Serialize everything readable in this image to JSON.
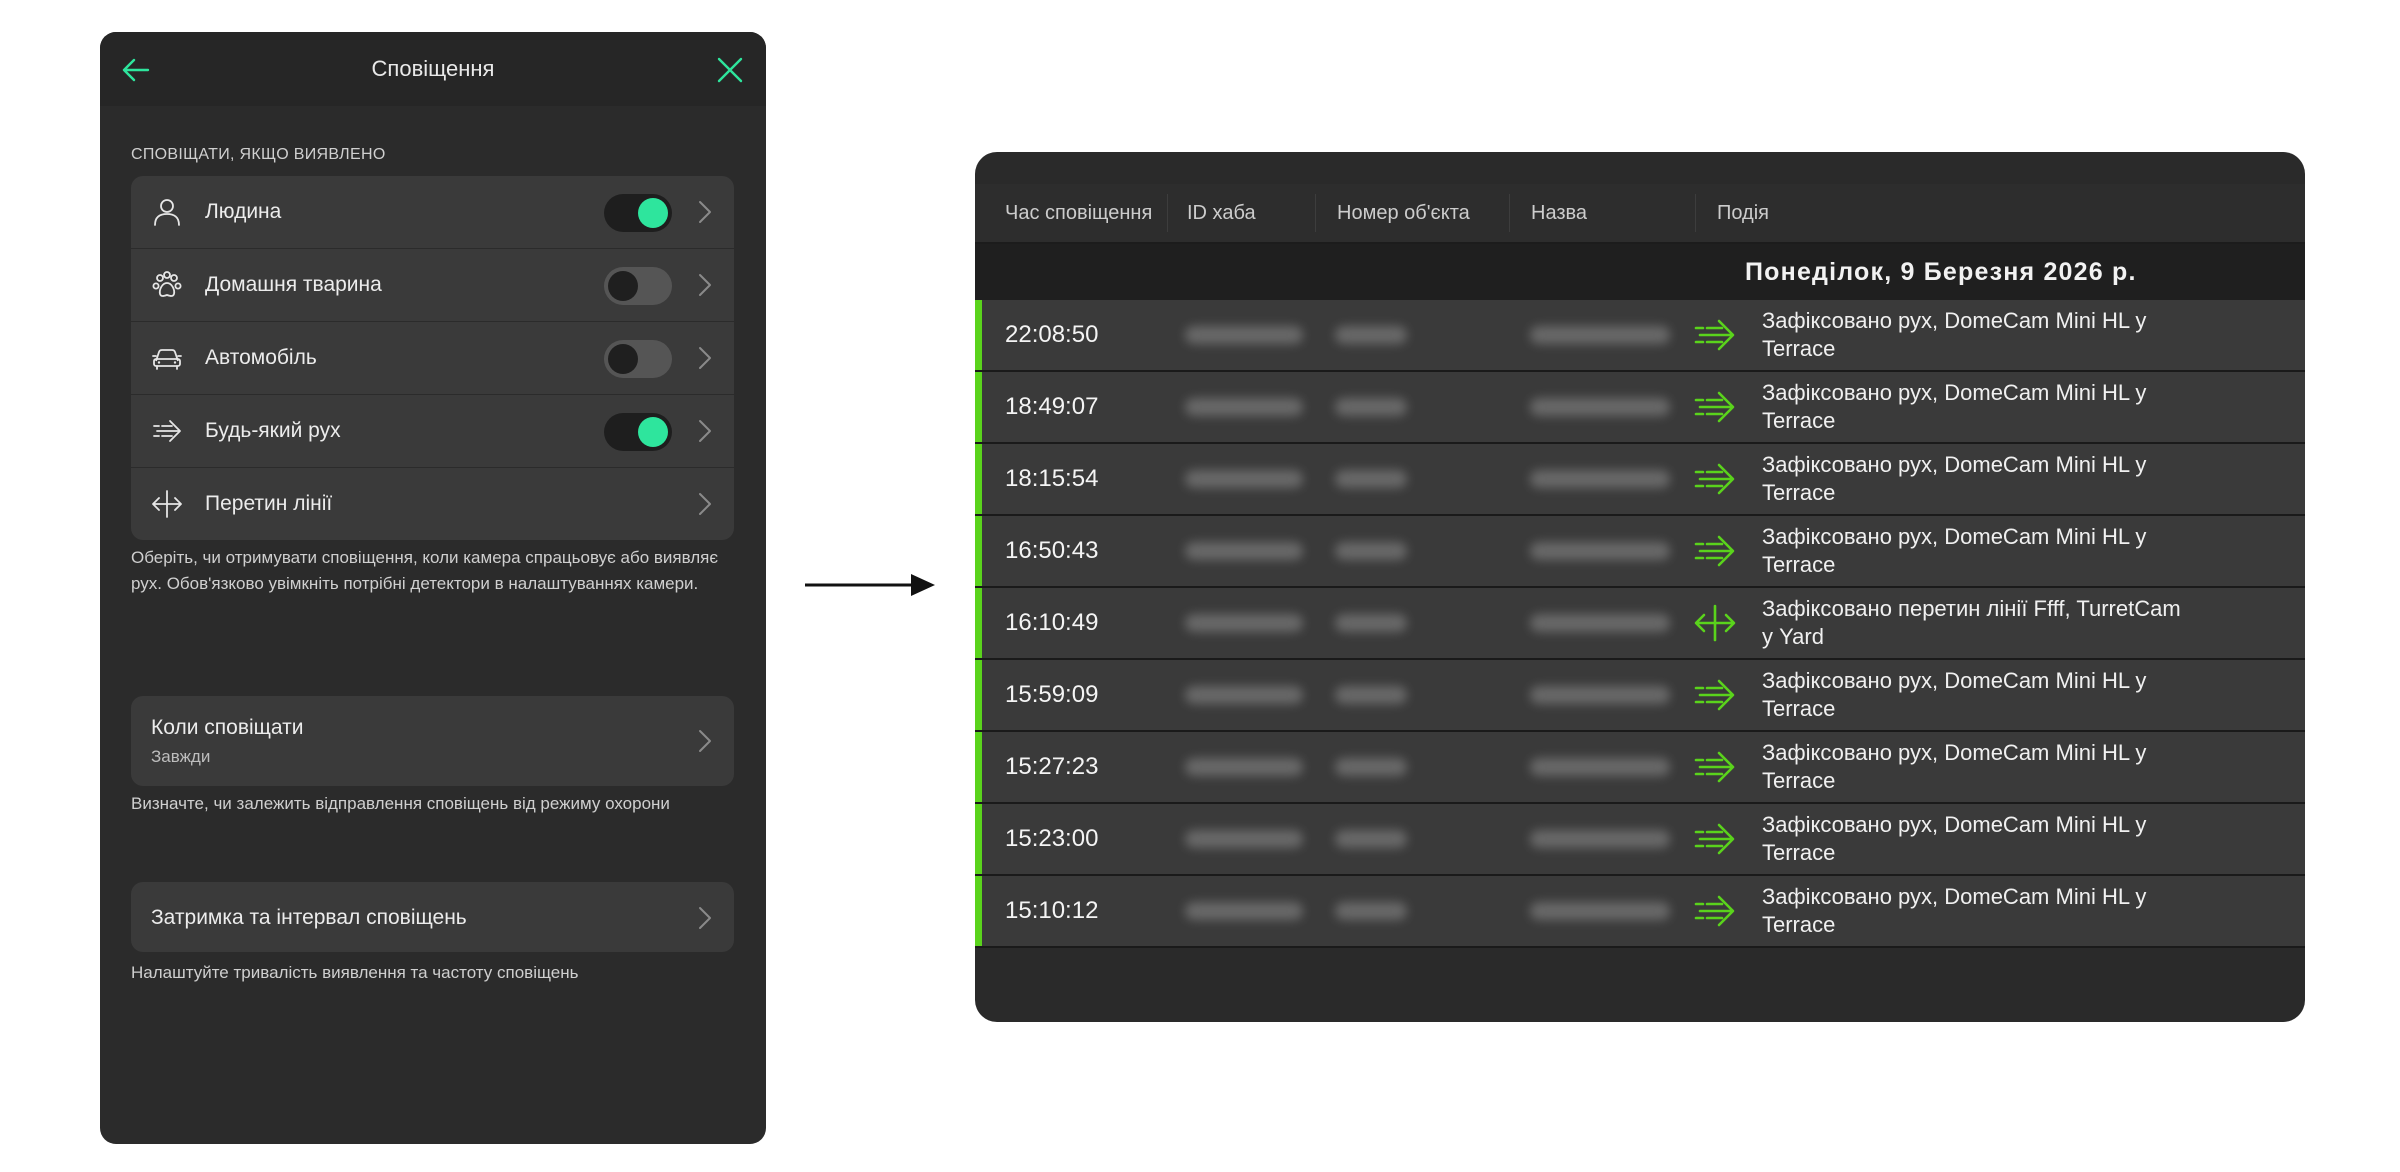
{
  "settings": {
    "header_title": "Сповіщення",
    "section_label": "СПОВІЩАТИ, ЯКЩО ВИЯВЛЕНО",
    "detectors": [
      {
        "label": "Людина",
        "icon": "person-icon",
        "toggle": true
      },
      {
        "label": "Домашня тварина",
        "icon": "paw-icon",
        "toggle": false
      },
      {
        "label": "Автомобіль",
        "icon": "car-icon",
        "toggle": false
      },
      {
        "label": "Будь-який рух",
        "icon": "motion-icon",
        "toggle": true
      },
      {
        "label": "Перетин лінії",
        "icon": "line-crossing-icon",
        "toggle": null
      }
    ],
    "detectors_desc": "Оберіть, чи отримувати сповіщення, коли камера спрацьовує або виявляє рух. Обов'язково увімкніть потрібні детектори в налаштуваннях камери.",
    "when": {
      "title": "Коли сповіщати",
      "subtitle": "Завжди"
    },
    "when_desc": "Визначте, чи залежить відправлення сповіщень від режиму охорони",
    "delay": {
      "title": "Затримка та інтервал сповіщень"
    },
    "delay_desc": "Налаштуйте тривалість виявлення та частоту сповіщень"
  },
  "colors": {
    "accent_green": "#2ee59d",
    "event_green": "#5ad31c"
  },
  "table": {
    "columns": [
      "Час сповіщення",
      "ID хаба",
      "Номер об'єкта",
      "Назва",
      "Подія"
    ],
    "date": "Понеділок, 9 Березня 2026 р.",
    "rows": [
      {
        "time": "22:08:50",
        "icon": "motion-icon",
        "event": "Зафіксовано рух, DomeCam Mini HL у Terrace"
      },
      {
        "time": "18:49:07",
        "icon": "motion-icon",
        "event": "Зафіксовано рух, DomeCam Mini HL у Terrace"
      },
      {
        "time": "18:15:54",
        "icon": "motion-icon",
        "event": "Зафіксовано рух, DomeCam Mini HL у Terrace"
      },
      {
        "time": "16:50:43",
        "icon": "motion-icon",
        "event": "Зафіксовано рух, DomeCam Mini HL у Terrace"
      },
      {
        "time": "16:10:49",
        "icon": "line-crossing-icon",
        "event": "Зафіксовано перетин лінії Ffff, TurretCam у Yard"
      },
      {
        "time": "15:59:09",
        "icon": "motion-icon",
        "event": "Зафіксовано рух, DomeCam Mini HL у Terrace"
      },
      {
        "time": "15:27:23",
        "icon": "motion-icon",
        "event": "Зафіксовано рух, DomeCam Mini HL у Terrace"
      },
      {
        "time": "15:23:00",
        "icon": "motion-icon",
        "event": "Зафіксовано рух, DomeCam Mini HL у Terrace"
      },
      {
        "time": "15:10:12",
        "icon": "motion-icon",
        "event": "Зафіксовано рух, DomeCam Mini HL у Terrace"
      }
    ]
  }
}
